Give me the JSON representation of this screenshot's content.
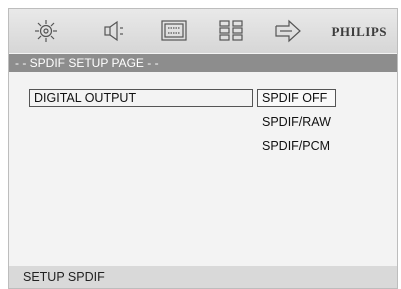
{
  "toolbar": {
    "icons": [
      "gear-icon",
      "speaker-icon",
      "monitor-icon",
      "grid-icon",
      "arrow-icon"
    ],
    "brand": "PHILIPS"
  },
  "page": {
    "title": "- - SPDIF SETUP PAGE - -"
  },
  "setting": {
    "label": "DIGITAL OUTPUT",
    "options": [
      "SPDIF OFF",
      "SPDIF/RAW",
      "SPDIF/PCM"
    ],
    "selected": "SPDIF OFF"
  },
  "status": {
    "text": "SETUP SPDIF"
  },
  "colors": {
    "background": "#f3f3f3",
    "page_bar": "#8d8d8d",
    "status_bar": "#d9d9d9"
  }
}
